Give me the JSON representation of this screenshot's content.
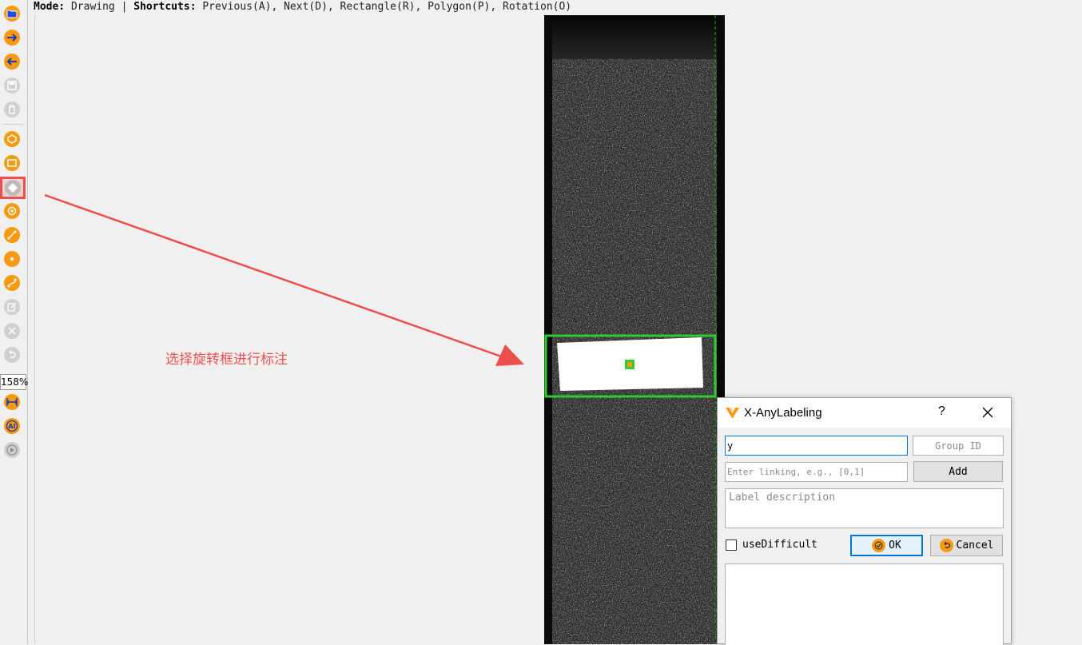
{
  "status_bar": {
    "mode_key": "Mode:",
    "mode_value": "Drawing",
    "shortcuts_key": "Shortcuts:",
    "shortcuts_value": "Previous(A), Next(D), Rectangle(R), Polygon(P), Rotation(O)"
  },
  "toolbar": {
    "zoom": "158%",
    "icons": [
      "open-dir-icon",
      "next-image-icon",
      "prev-image-icon",
      "save-icon",
      "delete-file-icon",
      "create-polygon-icon",
      "create-rectangle-icon",
      "create-rotation-icon",
      "create-circle-icon",
      "create-line-icon",
      "create-point-icon",
      "create-linestrip-icon",
      "edit-icon",
      "delete-shape-icon",
      "undo-icon",
      "fit-width-icon",
      "ai-icon",
      "run-icon"
    ],
    "active_tool": "create-rotation-icon"
  },
  "annotation": {
    "text": "选择旋转框进行标注",
    "color": "#ec5050"
  },
  "dialog": {
    "title": "X-AnyLabeling",
    "help": "?",
    "label_value": "y",
    "group_id_placeholder": "Group ID",
    "linking_placeholder": "Enter linking, e.g., [0,1]",
    "add_label": "Add",
    "description_placeholder": "Label description",
    "use_difficult_label": "useDifficult",
    "use_difficult_checked": false,
    "ok_label": "OK",
    "cancel_label": "Cancel"
  },
  "colors": {
    "accent": "#f59a12",
    "shape_outline": "#2ecc2e",
    "highlight": "#ec4d4d"
  }
}
